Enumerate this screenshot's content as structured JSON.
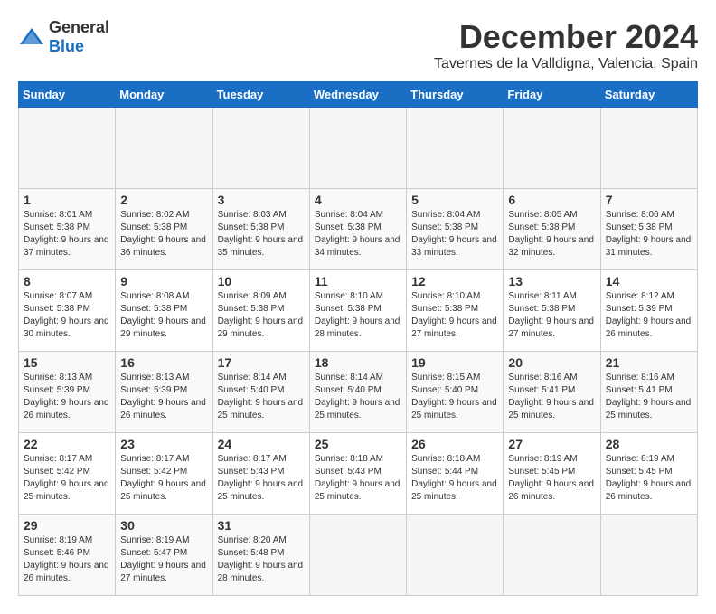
{
  "header": {
    "logo_general": "General",
    "logo_blue": "Blue",
    "month": "December 2024",
    "location": "Tavernes de la Valldigna, Valencia, Spain"
  },
  "calendar": {
    "days_of_week": [
      "Sunday",
      "Monday",
      "Tuesday",
      "Wednesday",
      "Thursday",
      "Friday",
      "Saturday"
    ],
    "weeks": [
      [
        {
          "day": "",
          "empty": true
        },
        {
          "day": "",
          "empty": true
        },
        {
          "day": "",
          "empty": true
        },
        {
          "day": "",
          "empty": true
        },
        {
          "day": "",
          "empty": true
        },
        {
          "day": "",
          "empty": true
        },
        {
          "day": "",
          "empty": true
        }
      ],
      [
        {
          "day": "1",
          "sunrise": "8:01 AM",
          "sunset": "5:38 PM",
          "daylight": "9 hours and 37 minutes."
        },
        {
          "day": "2",
          "sunrise": "8:02 AM",
          "sunset": "5:38 PM",
          "daylight": "9 hours and 36 minutes."
        },
        {
          "day": "3",
          "sunrise": "8:03 AM",
          "sunset": "5:38 PM",
          "daylight": "9 hours and 35 minutes."
        },
        {
          "day": "4",
          "sunrise": "8:04 AM",
          "sunset": "5:38 PM",
          "daylight": "9 hours and 34 minutes."
        },
        {
          "day": "5",
          "sunrise": "8:04 AM",
          "sunset": "5:38 PM",
          "daylight": "9 hours and 33 minutes."
        },
        {
          "day": "6",
          "sunrise": "8:05 AM",
          "sunset": "5:38 PM",
          "daylight": "9 hours and 32 minutes."
        },
        {
          "day": "7",
          "sunrise": "8:06 AM",
          "sunset": "5:38 PM",
          "daylight": "9 hours and 31 minutes."
        }
      ],
      [
        {
          "day": "8",
          "sunrise": "8:07 AM",
          "sunset": "5:38 PM",
          "daylight": "9 hours and 30 minutes."
        },
        {
          "day": "9",
          "sunrise": "8:08 AM",
          "sunset": "5:38 PM",
          "daylight": "9 hours and 29 minutes."
        },
        {
          "day": "10",
          "sunrise": "8:09 AM",
          "sunset": "5:38 PM",
          "daylight": "9 hours and 29 minutes."
        },
        {
          "day": "11",
          "sunrise": "8:10 AM",
          "sunset": "5:38 PM",
          "daylight": "9 hours and 28 minutes."
        },
        {
          "day": "12",
          "sunrise": "8:10 AM",
          "sunset": "5:38 PM",
          "daylight": "9 hours and 27 minutes."
        },
        {
          "day": "13",
          "sunrise": "8:11 AM",
          "sunset": "5:38 PM",
          "daylight": "9 hours and 27 minutes."
        },
        {
          "day": "14",
          "sunrise": "8:12 AM",
          "sunset": "5:39 PM",
          "daylight": "9 hours and 26 minutes."
        }
      ],
      [
        {
          "day": "15",
          "sunrise": "8:13 AM",
          "sunset": "5:39 PM",
          "daylight": "9 hours and 26 minutes."
        },
        {
          "day": "16",
          "sunrise": "8:13 AM",
          "sunset": "5:39 PM",
          "daylight": "9 hours and 26 minutes."
        },
        {
          "day": "17",
          "sunrise": "8:14 AM",
          "sunset": "5:40 PM",
          "daylight": "9 hours and 25 minutes."
        },
        {
          "day": "18",
          "sunrise": "8:14 AM",
          "sunset": "5:40 PM",
          "daylight": "9 hours and 25 minutes."
        },
        {
          "day": "19",
          "sunrise": "8:15 AM",
          "sunset": "5:40 PM",
          "daylight": "9 hours and 25 minutes."
        },
        {
          "day": "20",
          "sunrise": "8:16 AM",
          "sunset": "5:41 PM",
          "daylight": "9 hours and 25 minutes."
        },
        {
          "day": "21",
          "sunrise": "8:16 AM",
          "sunset": "5:41 PM",
          "daylight": "9 hours and 25 minutes."
        }
      ],
      [
        {
          "day": "22",
          "sunrise": "8:17 AM",
          "sunset": "5:42 PM",
          "daylight": "9 hours and 25 minutes."
        },
        {
          "day": "23",
          "sunrise": "8:17 AM",
          "sunset": "5:42 PM",
          "daylight": "9 hours and 25 minutes."
        },
        {
          "day": "24",
          "sunrise": "8:17 AM",
          "sunset": "5:43 PM",
          "daylight": "9 hours and 25 minutes."
        },
        {
          "day": "25",
          "sunrise": "8:18 AM",
          "sunset": "5:43 PM",
          "daylight": "9 hours and 25 minutes."
        },
        {
          "day": "26",
          "sunrise": "8:18 AM",
          "sunset": "5:44 PM",
          "daylight": "9 hours and 25 minutes."
        },
        {
          "day": "27",
          "sunrise": "8:19 AM",
          "sunset": "5:45 PM",
          "daylight": "9 hours and 26 minutes."
        },
        {
          "day": "28",
          "sunrise": "8:19 AM",
          "sunset": "5:45 PM",
          "daylight": "9 hours and 26 minutes."
        }
      ],
      [
        {
          "day": "29",
          "sunrise": "8:19 AM",
          "sunset": "5:46 PM",
          "daylight": "9 hours and 26 minutes."
        },
        {
          "day": "30",
          "sunrise": "8:19 AM",
          "sunset": "5:47 PM",
          "daylight": "9 hours and 27 minutes."
        },
        {
          "day": "31",
          "sunrise": "8:20 AM",
          "sunset": "5:48 PM",
          "daylight": "9 hours and 28 minutes."
        },
        {
          "day": "",
          "empty": true
        },
        {
          "day": "",
          "empty": true
        },
        {
          "day": "",
          "empty": true
        },
        {
          "day": "",
          "empty": true
        }
      ]
    ]
  }
}
